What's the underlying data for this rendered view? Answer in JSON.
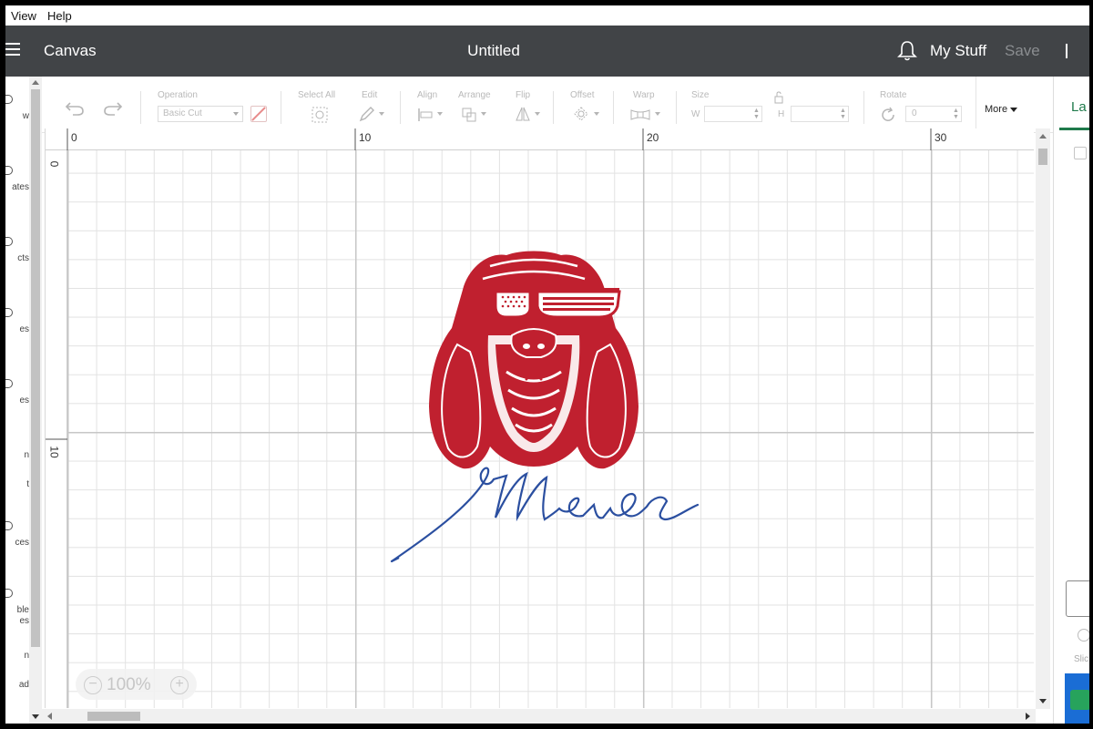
{
  "menu": {
    "items": [
      "View",
      "Help"
    ]
  },
  "header": {
    "section": "Canvas",
    "document_title": "Untitled",
    "my_stuff": "My Stuff",
    "save": "Save"
  },
  "left_rail": {
    "items": [
      {
        "label": "w",
        "icon": "new-icon"
      },
      {
        "label": "ates",
        "icon": "templates-icon"
      },
      {
        "label": "cts",
        "icon": "projects-icon"
      },
      {
        "label": "es",
        "icon": "images-icon"
      },
      {
        "label": "es",
        "icon": "shapes-icon"
      },
      {
        "label": "n",
        "icon": "text-icon"
      },
      {
        "label": "t",
        "icon": "text-icon-2"
      },
      {
        "label": "ces",
        "icon": "phrases-icon"
      },
      {
        "label": "ble",
        "icon": "editable-icon"
      },
      {
        "label": "es",
        "icon": "images-2-icon"
      },
      {
        "label": "n",
        "icon": "upload-icon"
      },
      {
        "label": "ad",
        "icon": "upload-2-icon"
      }
    ]
  },
  "toolbar": {
    "undo_icon": "undo-icon",
    "redo_icon": "redo-icon",
    "operation_label": "Operation",
    "operation_value": "Basic Cut",
    "select_all_label": "Select All",
    "edit_label": "Edit",
    "align_label": "Align",
    "arrange_label": "Arrange",
    "flip_label": "Flip",
    "offset_label": "Offset",
    "warp_label": "Warp",
    "size_label": "Size",
    "width_prefix": "W",
    "height_prefix": "H",
    "rotate_label": "Rotate",
    "rotate_value": "0",
    "more_label": "More"
  },
  "ruler": {
    "top_labels": [
      "0",
      "10",
      "20",
      "30"
    ],
    "left_labels": [
      "0",
      "10"
    ]
  },
  "zoom": {
    "level": "100%"
  },
  "design": {
    "text": "Merica",
    "head_color": "#c0202f",
    "text_color": "#2b4fa0"
  },
  "right_panel": {
    "tab_label": "La",
    "slice_label": "Slic"
  },
  "colors": {
    "header_bg": "#414447",
    "accent_green": "#1f7a4b",
    "save_disabled": "#8a8d90"
  }
}
